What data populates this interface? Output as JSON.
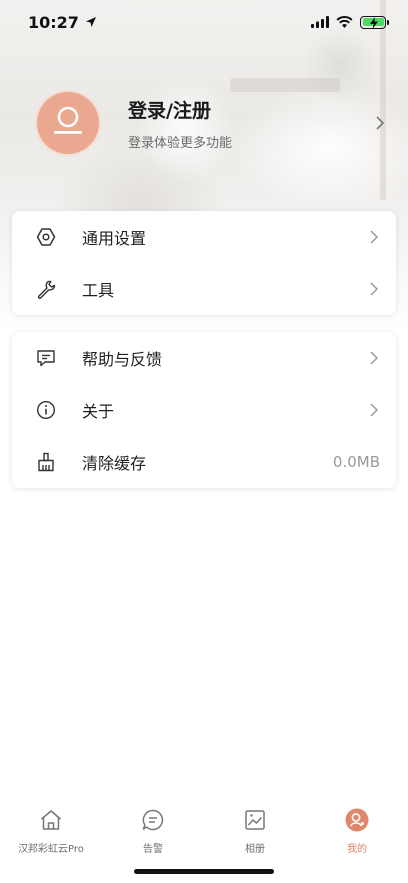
{
  "status_bar": {
    "time": "10:27"
  },
  "profile": {
    "title": "登录/注册",
    "subtitle": "登录体验更多功能",
    "avatar_color": "#e9a88f"
  },
  "menu_group_1": [
    {
      "icon": "hexagon-settings-icon",
      "label": "通用设置",
      "value": ""
    },
    {
      "icon": "wrench-icon",
      "label": "工具",
      "value": ""
    }
  ],
  "menu_group_2": [
    {
      "icon": "chat-bubble-icon",
      "label": "帮助与反馈",
      "value": ""
    },
    {
      "icon": "info-icon",
      "label": "关于",
      "value": ""
    },
    {
      "icon": "broom-icon",
      "label": "清除缓存",
      "value": "0.0MB"
    }
  ],
  "tabbar": {
    "active_color": "#e0876a",
    "tabs": [
      {
        "icon": "home-icon",
        "label": "汉邦彩虹云Pro"
      },
      {
        "icon": "alert-bubble-icon",
        "label": "告警"
      },
      {
        "icon": "album-icon",
        "label": "相册"
      },
      {
        "icon": "profile-icon",
        "label": "我的"
      }
    ],
    "active_tab": "我的"
  }
}
